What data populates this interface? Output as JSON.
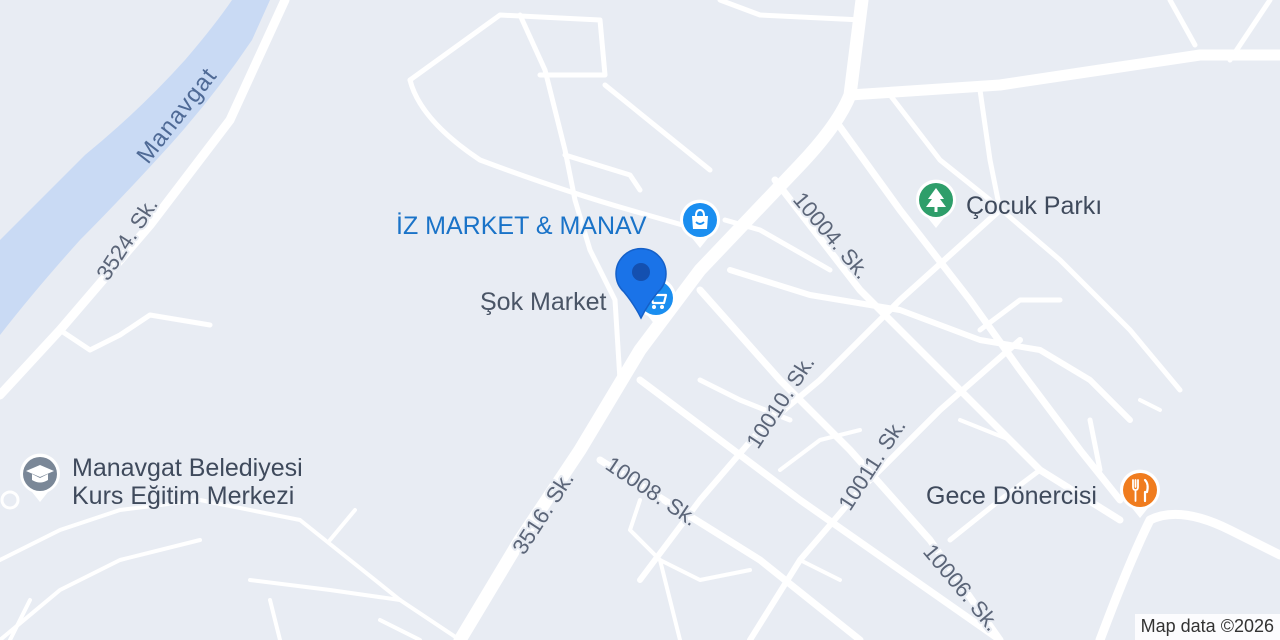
{
  "colors": {
    "land": "#e8ecf3",
    "road": "#ffffff",
    "water": "#c9daf4",
    "shopping": "#1a8ef0",
    "park": "#2e9e6a",
    "food": "#f07c1e",
    "education": "#7a8797",
    "location_pin": "#1a73e8"
  },
  "river": {
    "label": "Manavgat"
  },
  "streets": [
    {
      "label": "3524. Sk."
    },
    {
      "label": "3516. Sk."
    },
    {
      "label": "10004. Sk."
    },
    {
      "label": "10008. Sk."
    },
    {
      "label": "10010. Sk."
    },
    {
      "label": "10011. Sk."
    },
    {
      "label": "10006. Sk."
    }
  ],
  "pois": [
    {
      "name": "İZ MARKET & MANAV",
      "icon": "shopping-bag-icon",
      "category": "shopping"
    },
    {
      "name": "Şok Market",
      "icon": "shopping-cart-icon",
      "category": "shopping"
    },
    {
      "name": "Çocuk Parkı",
      "icon": "tree-icon",
      "category": "park"
    },
    {
      "name": "Gece Dönercisi",
      "icon": "fork-knife-icon",
      "category": "food"
    },
    {
      "name_line1": "Manavgat Belediyesi",
      "name_line2": "Kurs Eğitim Merkezi",
      "icon": "graduation-cap-icon",
      "category": "education"
    }
  ],
  "marker": {
    "icon": "location-pin-icon"
  },
  "attribution": "Map data ©2026"
}
